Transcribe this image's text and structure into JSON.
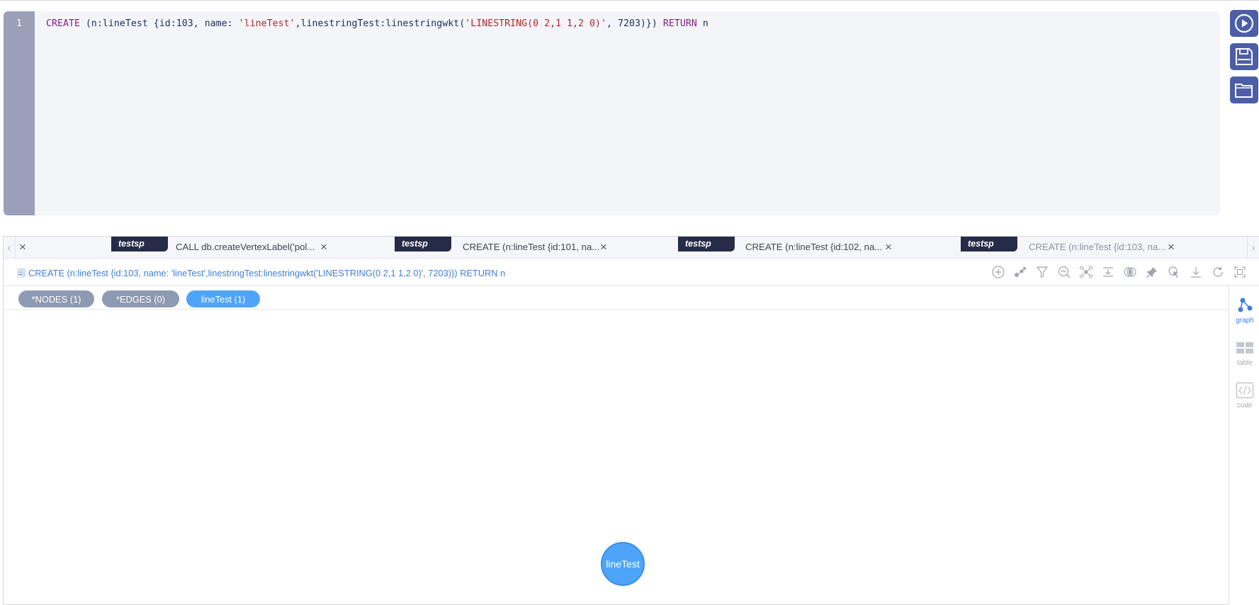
{
  "editor": {
    "line_number": "1",
    "code_tokens": [
      {
        "text": "CREATE",
        "cls": "kw"
      },
      {
        "text": " (n:lineTest {id:103, name: ",
        "cls": ""
      },
      {
        "text": "'lineTest'",
        "cls": "str"
      },
      {
        "text": ",linestringTest:linestringwkt(",
        "cls": ""
      },
      {
        "text": "'LINESTRING(0 2,1 1,2 0)'",
        "cls": "str"
      },
      {
        "text": ", 7203)}) ",
        "cls": ""
      },
      {
        "text": "RETURN",
        "cls": "kw"
      },
      {
        "text": " n",
        "cls": ""
      }
    ]
  },
  "side_buttons": [
    {
      "name": "run-button",
      "icon": "play-circle-icon"
    },
    {
      "name": "save-button",
      "icon": "floppy-disk-icon"
    },
    {
      "name": "open-button",
      "icon": "folder-icon"
    }
  ],
  "tabs": [
    {
      "db": "testsp",
      "label": "CALL db.createVertexLabel('pol...",
      "active": false
    },
    {
      "db": "testsp",
      "label": "CREATE (n:lineTest {id:101, na...",
      "active": false
    },
    {
      "db": "testsp",
      "label": "CREATE (n:lineTest {id:102, na...",
      "active": false
    },
    {
      "db": "testsp",
      "label": "CREATE (n:lineTest {id:103, na...",
      "active": true
    }
  ],
  "query_bar": {
    "text": "CREATE (n:lineTest {id:103, name: 'lineTest',linestringTest:linestringwkt('LINESTRING(0 2,1 1,2 0)', 7203)}) RETURN n"
  },
  "toolbar_icons": [
    "add-circle-icon",
    "expand-nodes-icon",
    "filter-icon",
    "search-path-icon",
    "graph-layout-icon",
    "fit-rows-icon",
    "overlap-icon",
    "pin-icon",
    "pointer-select-icon",
    "download-icon",
    "refresh-icon",
    "fullscreen-icon"
  ],
  "filters": {
    "nodes": "*NODES (1)",
    "edges": "*EDGES (0)",
    "label": "lineTest (1)"
  },
  "views": {
    "graph": "graph",
    "table": "table",
    "code": "code"
  },
  "graph": {
    "node_label": "lineTest"
  },
  "colors": {
    "accent": "#4ea4f8",
    "button_bg": "#4b5ea7",
    "db_tag_bg": "#262c48",
    "pill_grey": "#8e9ab1"
  }
}
